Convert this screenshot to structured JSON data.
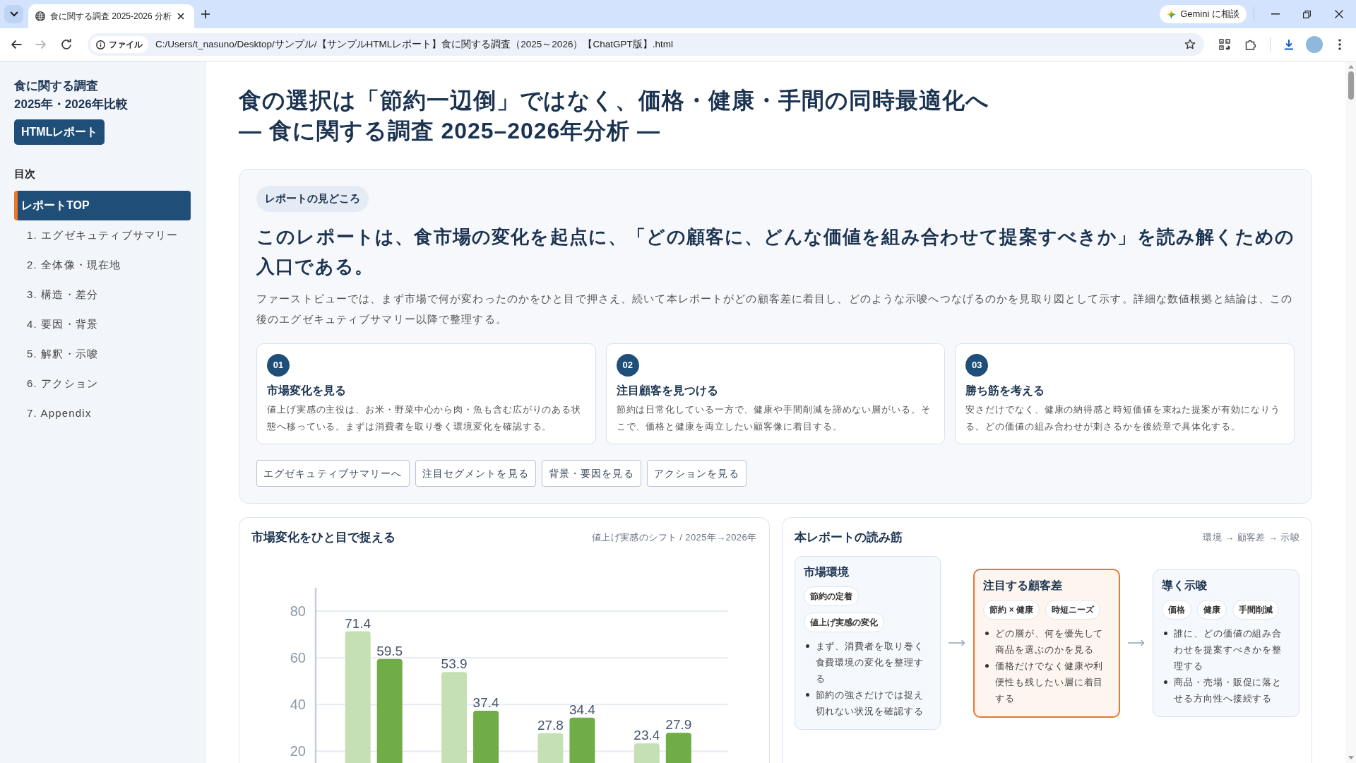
{
  "browser": {
    "tabs": [
      {
        "title": "食に関する調査 2025-2026 分析",
        "selected": true
      }
    ],
    "gemini_button": "Gemini に相談",
    "nav_buttons": [
      {
        "kind": "back",
        "disabled": false
      },
      {
        "kind": "forward",
        "disabled": true
      },
      {
        "kind": "reload",
        "disabled": false
      }
    ],
    "address_bar": {
      "chip": "ファイル",
      "url": "C:/Users/t_nasuno/Desktop/サンプル/【サンプルHTMLレポート】食に関する調査（2025～2026）【ChatGPT版】.html"
    }
  },
  "sidebar": {
    "title": [
      "食に関する調査",
      "2025年・2026年比較"
    ],
    "label": "HTMLレポート",
    "toc_heading": "目次",
    "items": [
      {
        "label": "レポートTOP",
        "selected": true
      },
      {
        "label": "1. エグゼキュティブサマリー",
        "selected": false
      },
      {
        "label": "2. 全体像・現在地",
        "selected": false
      },
      {
        "label": "3. 構造・差分",
        "selected": false
      },
      {
        "label": "4. 要因・背景",
        "selected": false
      },
      {
        "label": "5. 解釈・示唆",
        "selected": false
      },
      {
        "label": "6. アクション",
        "selected": false
      },
      {
        "label": "7. Appendix",
        "selected": false
      }
    ]
  },
  "page_title": [
    "食の選択は「節約一辺倒」ではなく、価格・健康・手間の同時最適化へ",
    "— 食に関する調査 2025–2026年分析 —"
  ],
  "overview": {
    "tag": "レポートの見どころ",
    "headline": "このレポートは、食市場の変化を起点に、「どの顧客に、どんな価値を組み合わせて提案すべきか」を読み解くための入口である。",
    "lead": "ファーストビューでは、まず市場で何が変わったのかをひと目で押さえ、続いて本レポートがどの顧客差に着目し、どのような示唆へつなげるのかを見取り図として示す。詳細な数値根拠と結論は、この後のエグゼキュティブサマリー以降で整理する。",
    "points": [
      {
        "number": "01",
        "title": "市場変化を見る",
        "text": "値上げ実感の主役は、お米・野菜中心から肉・魚も含む広がりのある状態へ移っている。まずは消費者を取り巻く環境変化を確認する。"
      },
      {
        "number": "02",
        "title": "注目顧客を見つける",
        "text": "節約は日常化している一方で、健康や手間削減を諦めない層がいる。そこで、価格と健康を両立したい顧客像に着目する。"
      },
      {
        "number": "03",
        "title": "勝ち筋を考える",
        "text": "安さだけでなく、健康の納得感と時短価値を束ねた提案が有効になりうる。どの価値の組み合わせが刺さるかを後続章で具体化する。"
      }
    ],
    "links": [
      "エグゼキュティブサマリーへ",
      "注目セグメントを見る",
      "背景・要因を見る",
      "アクションを見る"
    ]
  },
  "chart_panel": {
    "title": "市場変化をひと目で捉える",
    "subtitle": "値上げ実感のシフト / 2025年→2026年",
    "chart_data": {
      "type": "bar",
      "series": [
        {
          "color": "#c5e0b4",
          "values": [
            71.4,
            53.9,
            27.8,
            23.4
          ]
        },
        {
          "color": "#70ad47",
          "values": [
            59.5,
            37.4,
            34.4,
            27.9
          ]
        }
      ],
      "ylim": [
        15,
        90
      ],
      "yticks": [
        20,
        40,
        60,
        80
      ],
      "grid": true,
      "data_labels": true
    }
  },
  "flow_panel": {
    "title": "本レポートの読み筋",
    "subtitle": "環境 → 顧客差 → 示唆",
    "steps": [
      {
        "title": "市場環境",
        "highlighted": false,
        "tags": [
          "節約の定着",
          "値上げ実感の変化"
        ],
        "points": [
          "まず、消費者を取り巻く食費環境の変化を整理する",
          "節約の強さだけでは捉え切れない状況を確認する"
        ]
      },
      {
        "title": "注目する顧客差",
        "highlighted": true,
        "tags": [
          "節約 × 健康",
          "時短ニーズ"
        ],
        "points": [
          "どの層が、何を優先して商品を選ぶのかを見る",
          "価格だけでなく健康や利便性も残したい層に着目する"
        ]
      },
      {
        "title": "導く示唆",
        "highlighted": false,
        "tags": [
          "価格",
          "健康",
          "手間削減"
        ],
        "points": [
          "誰に、どの価値の組み合わせを提案すべきかを整理する",
          "商品・売場・販促に落とせる方向性へ接続する"
        ]
      }
    ]
  }
}
